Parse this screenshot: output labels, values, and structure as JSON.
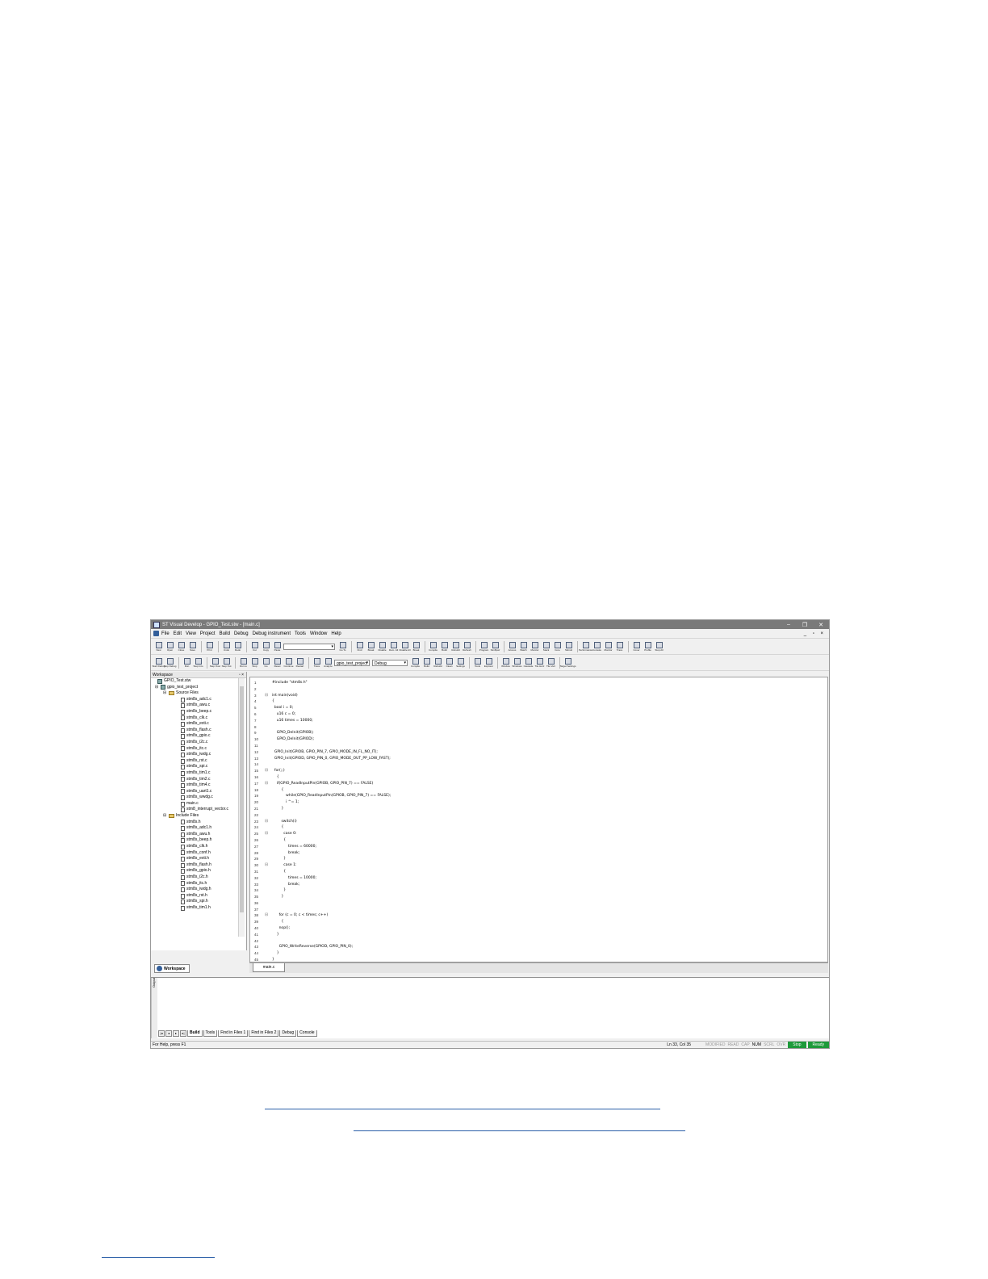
{
  "window": {
    "title": "ST Visual Develop - GPIO_Test.stw - [main.c]",
    "controls": [
      "–",
      "❐",
      "✕"
    ]
  },
  "menu": [
    "File",
    "Edit",
    "View",
    "Project",
    "Build",
    "Debug",
    "Debug instrument",
    "Tools",
    "Window",
    "Help"
  ],
  "mdi_controls": "_ ▫ ×",
  "toolbar1": [
    "New",
    "Open",
    "Close",
    "Save",
    "Print",
    "Undo",
    "Redo",
    "Cut",
    "Copy",
    "Paste",
    "Go To",
    "Find",
    "Break",
    "Disable",
    "Rem. All",
    "Disable All",
    "Break",
    "Compile",
    "Build",
    "Rebuild",
    "Refresh",
    "Program",
    "Stm8pwr",
    "Access",
    "Watch",
    "Monitor",
    "Stack",
    "Core",
    "Stimuli",
    "Performance",
    "Console",
    "Monitor",
    "Trace",
    "Cover",
    "Profile",
    "Stop All"
  ],
  "combo_blank": "",
  "toolbar2": [
    "Start Debug",
    "Stop Debug",
    "Run",
    "Step Into",
    "Step Over",
    "Step Out",
    "Run to",
    "Stop",
    "Go",
    "Reset",
    "Continue",
    "Restart",
    "Trace",
    "Analyze"
  ],
  "project_combo": "gpio_test_project",
  "config_combo": "Debug",
  "toolbar3": [
    "Compile",
    "Build",
    "Rebuild",
    "Clean",
    "Settings",
    "Tools",
    "Explorer",
    "Window",
    "Windows",
    "Cascade",
    "Tile Horz",
    "Tile Vert",
    "Target Settings"
  ],
  "workspace": {
    "header": "Workspace",
    "close": "▫ ×",
    "root": "GPIO_Test.stw",
    "project": "gpio_test_project",
    "source_folder": "Source Files",
    "sources": [
      "stm8s_adc1.c",
      "stm8s_awu.c",
      "stm8s_beep.c",
      "stm8s_clk.c",
      "stm8s_exti.c",
      "stm8s_flash.c",
      "stm8s_gpio.c",
      "stm8s_i2c.c",
      "stm8s_itc.c",
      "stm8s_iwdg.c",
      "stm8s_rst.c",
      "stm8s_spi.c",
      "stm8s_tim1.c",
      "stm8s_tim2.c",
      "stm8s_tim4.c",
      "stm8s_uart1.c",
      "stm8s_wwdg.c",
      "main.c",
      "stm8_interrupt_vector.c"
    ],
    "include_folder": "Include Files",
    "includes": [
      "stm8s.h",
      "stm8s_adc1.h",
      "stm8s_awu.h",
      "stm8s_beep.h",
      "stm8s_clk.h",
      "stm8s_conf.h",
      "stm8s_exti.h",
      "stm8s_flash.h",
      "stm8s_gpio.h",
      "stm8s_i2c.h",
      "stm8s_itc.h",
      "stm8s_iwdg.h",
      "stm8s_rst.h",
      "stm8s_spi.h",
      "stm8s_tim1.h"
    ],
    "tab": "Workspace"
  },
  "editor": {
    "tab": "main.c",
    "lines": [
      "#include \"stm8s.h\"",
      "",
      "int main(void)",
      "{",
      "  bool i = 0;",
      "    u16 c = 0;",
      "    u16 times = 10000;",
      "",
      "    GPIO_DeInit(GPIOB);",
      "    GPIO_DeInit(GPIOD);",
      "",
      "  GPIO_Init(GPIOB, GPIO_PIN_7, GPIO_MODE_IN_FL_NO_IT);",
      "  GPIO_Init(GPIOD, GPIO_PIN_0, GPIO_MODE_OUT_PP_LOW_FAST);",
      "",
      "  for(;;)",
      "    {",
      "    if(GPIO_ReadInputPin(GPIOB, GPIO_PIN_7) == FALSE)",
      "        {",
      "            while(GPIO_ReadInputPin(GPIOB, GPIO_PIN_7) == FALSE);",
      "            i ^= 1;",
      "        }",
      "",
      "        switch(i)",
      "        {",
      "          case 0:",
      "          {",
      "              times = 60000;",
      "              break;",
      "          }",
      "          case 1:",
      "          {",
      "              times = 10000;",
      "              break;",
      "          }",
      "        }",
      "",
      "",
      "      for (c = 0; c < times; c++)",
      "        {",
      "      nop();",
      "    }",
      "",
      "      GPIO_WriteReverse(GPIOD, GPIO_PIN_0);",
      "    }",
      "}"
    ]
  },
  "output": {
    "side_label": "Output",
    "nav": [
      "|◂",
      "◂",
      "▸",
      "▸|"
    ],
    "tabs": [
      "Build",
      "Tools",
      "Find in Files 1",
      "Find in Files 2",
      "Debug",
      "Console"
    ]
  },
  "status": {
    "help": "For Help, press F1",
    "position": "Ln 33, Col 35",
    "indicators": [
      "MODIFIED",
      "READ",
      "CAP",
      "NUM",
      "SCRL",
      "OVR"
    ],
    "active_indicator": "NUM",
    "stop": "Stop",
    "ready": "Ready"
  }
}
